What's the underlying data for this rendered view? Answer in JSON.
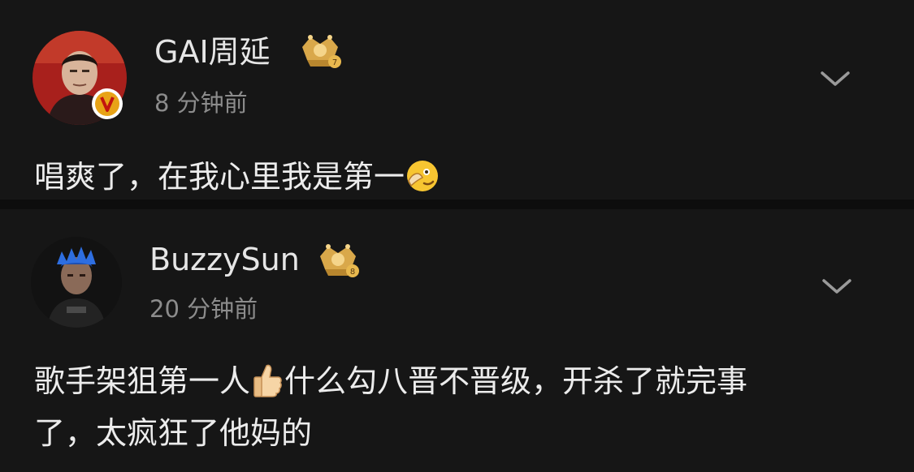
{
  "comments": [
    {
      "username": "GAI周延",
      "time": "8 分钟前",
      "text": "唱爽了，在我心里我是第一",
      "verified_badge": "v",
      "rank_badge": "crown-level-badge",
      "trailing_emoji": "wink-emoji"
    },
    {
      "username": "BuzzySun",
      "time": "20 分钟前",
      "line1_a": "歌手架狙第一人",
      "line1_b": "什么勾八晋不晋级，开杀了就完事",
      "line2": "了，太疯狂了他妈的",
      "rank_badge": "crown-level-badge",
      "inline_emoji": "thumbs-up-emoji"
    }
  ],
  "colors": {
    "background": "#161616",
    "text": "#ececec",
    "secondary": "#8c8c8c",
    "verified": "#e8a317",
    "badge_gold": "#d9a84a"
  }
}
